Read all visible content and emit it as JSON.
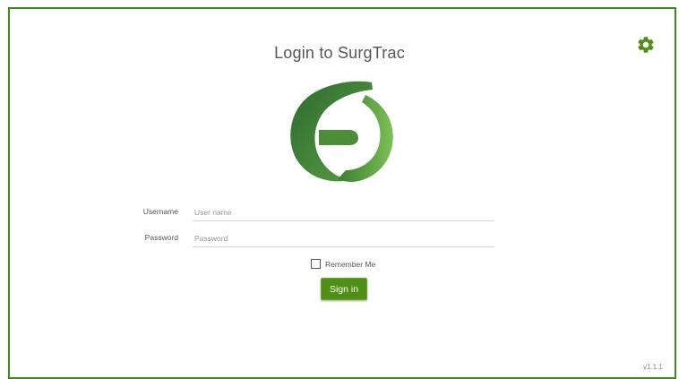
{
  "login": {
    "title": "Login to SurgTrac",
    "username_label": "Username",
    "username_placeholder": "User name",
    "password_label": "Password",
    "password_placeholder": "Password",
    "remember_label": "Remember Me",
    "remember_checked": false,
    "signin_label": "Sign in"
  },
  "footer": {
    "version": "v1.1.1"
  },
  "colors": {
    "accent": "#4f8f16",
    "border": "#3f8a1c",
    "logo_dark": "#2e6b2f",
    "logo_light": "#6ab04c"
  },
  "icons": {
    "settings": "gear-icon",
    "logo": "surgtrac-logo"
  }
}
